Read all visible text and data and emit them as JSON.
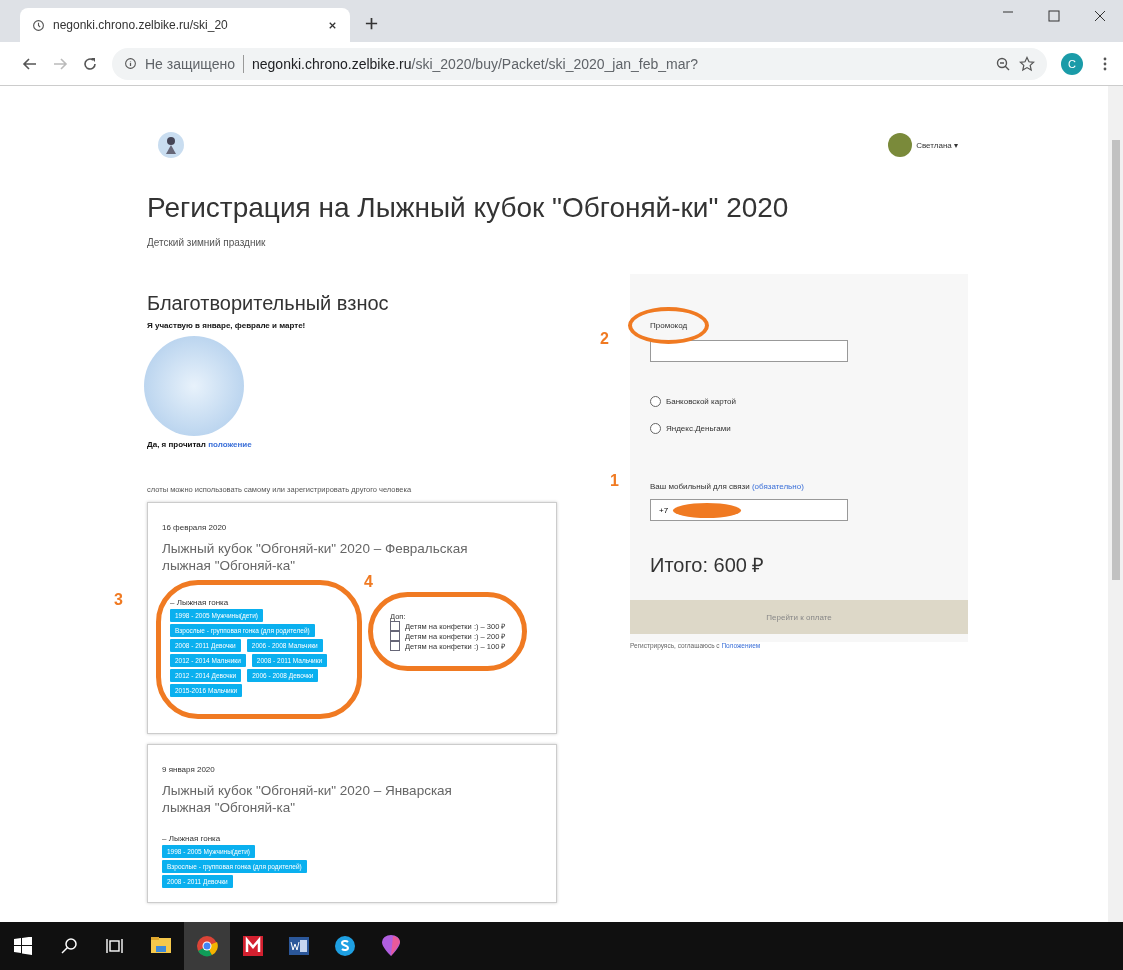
{
  "browser": {
    "tab_title": "negonki.chrono.zelbike.ru/ski_20",
    "security": "Не защищено",
    "url_host": "negonki.chrono.zelbike.ru",
    "url_path": "/ski_2020/buy/Packet/ski_2020_jan_feb_mar?",
    "profile_initial": "C"
  },
  "page": {
    "user_name": "Светлана",
    "user_caret": "▾",
    "title": "Регистрация на Лыжный кубок \"Обгоняй-ки\" 2020",
    "subtitle": "Детский зимний праздник",
    "section_title": "Благотворительный взнос",
    "bold_note": "Я участвую в январе, феврале и марте!",
    "agreement": {
      "text": "Да, я прочитал",
      "link": "положение"
    },
    "slots_note": "слоты можно использовать самому или зарегистрировать другого человека",
    "events": [
      {
        "date": "16 февраля 2020",
        "title": "Лыжный кубок \"Обгоняй-ки\" 2020 – Февральская лыжная \"Обгоняй-ка\"",
        "group_label": "– Лыжная гонка",
        "categories": [
          "1998 - 2005 Мужчины(дети)",
          "Взрослые - групповая гонка (для родителей)",
          "2008 - 2011 Девочки",
          "2006 - 2008 Мальчики",
          "2012 - 2014 Мальчики",
          "2008 - 2011 Мальчики",
          "2012 - 2014 Девочки",
          "2006 - 2008 Девочки",
          "2015-2016 Мальчики"
        ],
        "extras_label": "Доп:",
        "extras": [
          {
            "label": "Детям на конфетки :) – 300 ₽",
            "checked": false
          },
          {
            "label": "Детям на конфетки :) – 200 ₽",
            "checked": false
          },
          {
            "label": "Детям на конфетки :) – 100 ₽",
            "checked": false
          }
        ]
      },
      {
        "date": "9 января 2020",
        "title": "Лыжный кубок \"Обгоняй-ки\" 2020 – Январская лыжная \"Обгоняй-ка\"",
        "group_label": "– Лыжная гонка",
        "categories": [
          "1998 - 2005 Мужчины(дети)",
          "Взрослые - групповая гонка (для родителей)",
          "2008 - 2011 Девочки"
        ]
      }
    ]
  },
  "payment": {
    "promo_label": "Промокод",
    "methods": [
      {
        "label": "Банковской картой",
        "selected": false
      },
      {
        "label": "Яндекс.Деньгами",
        "selected": false
      }
    ],
    "phone_label": "Ваш мобильный для связи",
    "phone_link": "(обязательно)",
    "phone_value": "+7",
    "total": "Итого: 600 ₽",
    "pay_button": "Перейти к оплате",
    "footer_text": "Регистрируясь, соглашаюсь с",
    "footer_link": "Положением"
  },
  "annotations": [
    {
      "number": "2"
    },
    {
      "number": "1"
    },
    {
      "number": "3"
    },
    {
      "number": "4"
    }
  ],
  "taskbar": {
    "apps": [
      {
        "kind": "files",
        "active": false
      },
      {
        "kind": "chrome",
        "active": true
      },
      {
        "kind": "mail",
        "active": false
      },
      {
        "kind": "word",
        "active": false
      },
      {
        "kind": "skype",
        "active": false
      },
      {
        "kind": "paint",
        "active": false
      }
    ]
  }
}
